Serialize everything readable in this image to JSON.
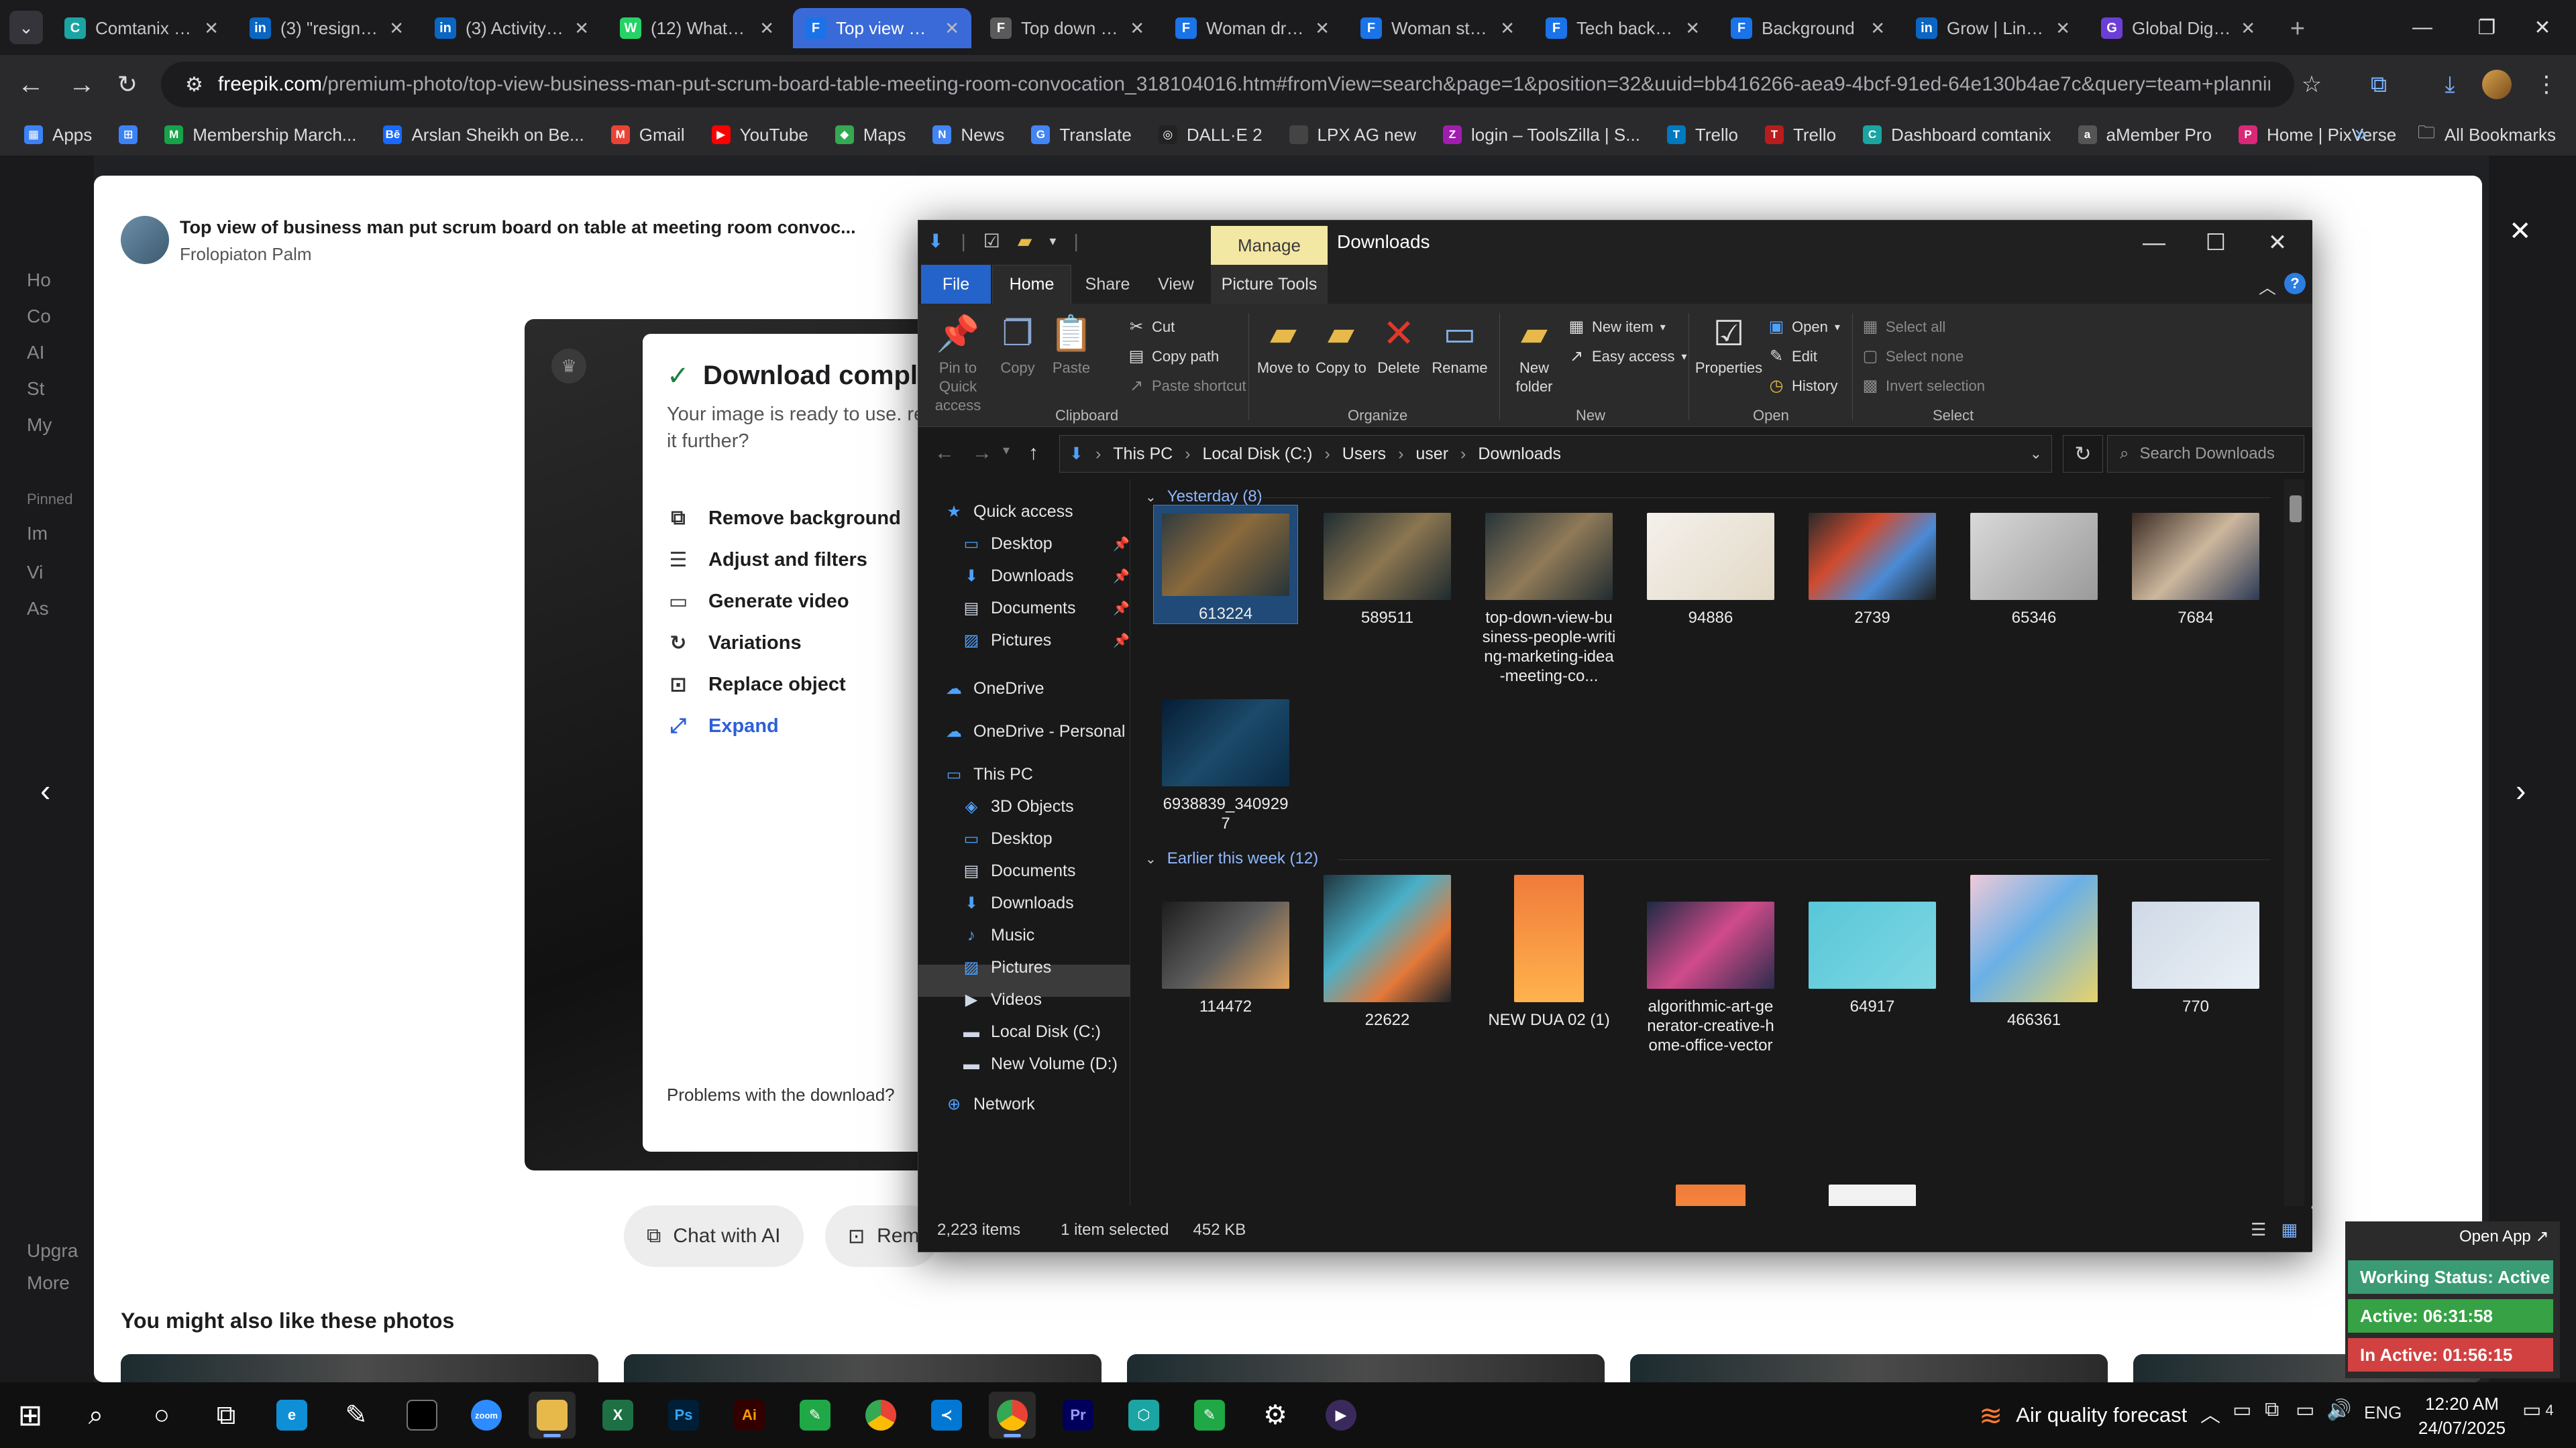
{
  "browser": {
    "tabs": [
      {
        "title": "Comtanix HR",
        "icon_color": "#1aa5a3",
        "icon": "C",
        "active": false
      },
      {
        "title": "(3) \"resignation\"",
        "icon_color": "#0a66c2",
        "icon": "in",
        "active": false
      },
      {
        "title": "(3) Activity | LinkedIn",
        "icon_color": "#0a66c2",
        "icon": "in",
        "active": false
      },
      {
        "title": "(12) WhatsApp",
        "icon_color": "#25d366",
        "icon": "W",
        "active": false
      },
      {
        "title": "Top view of business man",
        "icon_color": "#1a73e8",
        "icon": "F",
        "active": true
      },
      {
        "title": "Top down view",
        "icon_color": "#5a5a5a",
        "icon": "F",
        "active": false
      },
      {
        "title": "Woman drawing",
        "icon_color": "#1a73e8",
        "icon": "F",
        "active": false
      },
      {
        "title": "Woman standing",
        "icon_color": "#1a73e8",
        "icon": "F",
        "active": false
      },
      {
        "title": "Tech background",
        "icon_color": "#1a73e8",
        "icon": "F",
        "active": false
      },
      {
        "title": "Background",
        "icon_color": "#1a73e8",
        "icon": "F",
        "active": false
      },
      {
        "title": "Grow | LinkedIn",
        "icon_color": "#0a66c2",
        "icon": "in",
        "active": false
      },
      {
        "title": "Global Digital",
        "icon_color": "#6b3fd6",
        "icon": "G",
        "active": false
      }
    ],
    "url_host": "freepik.com",
    "url_path": "/premium-photo/top-view-business-man-put-scrum-board-table-meeting-room-convocation_318104016.htm#fromView=search&page=1&position=32&uuid=bb416266-aea9-4bcf-91ed-64e130b4ae7c&query=team+planning+",
    "bookmarks": [
      {
        "label": "Apps",
        "color": "#3b82f6",
        "icon": "▦"
      },
      {
        "label": "",
        "color": "#3b82f6",
        "icon": "⊞"
      },
      {
        "label": "Membership March...",
        "color": "#16a34a",
        "icon": "M"
      },
      {
        "label": "Arslan Sheikh on Be...",
        "color": "#1769ff",
        "icon": "Bē"
      },
      {
        "label": "Gmail",
        "color": "#ea4335",
        "icon": "M"
      },
      {
        "label": "YouTube",
        "color": "#ff0000",
        "icon": "▶"
      },
      {
        "label": "Maps",
        "color": "#34a853",
        "icon": "◆"
      },
      {
        "label": "News",
        "color": "#4285f4",
        "icon": "N"
      },
      {
        "label": "Translate",
        "color": "#4285f4",
        "icon": "G"
      },
      {
        "label": "DALL·E 2",
        "color": "#222222",
        "icon": "◎"
      },
      {
        "label": "LPX AG new",
        "color": "#444444",
        "icon": " "
      },
      {
        "label": "login – ToolsZilla | S...",
        "color": "#a21caf",
        "icon": "Z"
      },
      {
        "label": "Trello",
        "color": "#0079bf",
        "icon": "T"
      },
      {
        "label": "Trello",
        "color": "#b91c1c",
        "icon": "T"
      },
      {
        "label": "Dashboard comtanix",
        "color": "#1aa5a3",
        "icon": "C"
      },
      {
        "label": "aMember Pro",
        "color": "#555555",
        "icon": "a"
      },
      {
        "label": "Home | PixVerse",
        "color": "#db2777",
        "icon": "P"
      }
    ],
    "all_bookmarks": "All Bookmarks"
  },
  "freepik": {
    "photo_title": "Top view of business man put scrum board on table at meeting room convoc...",
    "author": "Frolopiaton Palm",
    "download": {
      "title": "Download complete",
      "subtitle": "Your image is ready to use. refine it further?",
      "options": [
        {
          "label": "Remove background",
          "icon": "⧉",
          "link": false
        },
        {
          "label": "Adjust and filters",
          "icon": "☰",
          "link": false
        },
        {
          "label": "Generate video",
          "icon": "▭",
          "link": false
        },
        {
          "label": "Variations",
          "icon": "↻",
          "link": false
        },
        {
          "label": "Replace object",
          "icon": "⊡",
          "link": false
        },
        {
          "label": "Expand",
          "icon": "⤢",
          "link": true
        }
      ],
      "problems": "Problems with the download?"
    },
    "chat_ai": "Chat with AI",
    "remove_btn": "Remo",
    "also_like": "You might also like these photos",
    "sidebar": [
      "Ho",
      "Co",
      "AI",
      "St",
      "My",
      "Pinned",
      "Im",
      "Vi",
      "As",
      "Upgra",
      "More"
    ]
  },
  "explorer": {
    "title": "Downloads",
    "manage": "Manage",
    "tabs": {
      "file": "File",
      "home": "Home",
      "share": "Share",
      "view": "View",
      "picture": "Picture Tools"
    },
    "ribbon": {
      "pin": "Pin to Quick access",
      "copy": "Copy",
      "paste": "Paste",
      "cut": "Cut",
      "copy_path": "Copy path",
      "paste_shortcut": "Paste shortcut",
      "clipboard": "Clipboard",
      "move_to": "Move to",
      "copy_to": "Copy to",
      "delete": "Delete",
      "rename": "Rename",
      "organize": "Organize",
      "new_folder": "New folder",
      "new_item": "New item",
      "easy_access": "Easy access",
      "new": "New",
      "properties": "Properties",
      "open": "Open",
      "edit": "Edit",
      "history": "History",
      "open_group": "Open",
      "select_all": "Select all",
      "select_none": "Select none",
      "invert": "Invert selection",
      "select": "Select"
    },
    "breadcrumb": [
      "This PC",
      "Local Disk (C:)",
      "Users",
      "user",
      "Downloads"
    ],
    "search_placeholder": "Search Downloads",
    "nav": {
      "quick_access": "Quick access",
      "qa_items": [
        "Desktop",
        "Downloads",
        "Documents",
        "Pictures"
      ],
      "onedrive": "OneDrive",
      "onedrive_personal": "OneDrive - Personal",
      "this_pc": "This PC",
      "pc_items": [
        "3D Objects",
        "Desktop",
        "Documents",
        "Downloads",
        "Music",
        "Pictures",
        "Videos",
        "Local Disk (C:)",
        "New Volume (D:)"
      ],
      "network": "Network"
    },
    "groups": [
      {
        "label": "Yesterday (8)"
      },
      {
        "label": "Earlier this week (12)"
      }
    ],
    "yesterday_files": [
      "613224",
      "589511",
      "top-down-view-business-people-writing-marketing-idea-meeting-co...",
      "94886",
      "2739",
      "65346",
      "7684",
      "6938839_3409297"
    ],
    "week_files": [
      "114472",
      "22622",
      "NEW DUA 02 (1)",
      "algorithmic-art-generator-creative-home-office-vector",
      "64917",
      "466361",
      "770"
    ],
    "status": {
      "items": "2,223 items",
      "selected": "1 item selected",
      "size": "452 KB"
    }
  },
  "tracker": {
    "open_app": "Open App ↗",
    "working": "Working Status: Active",
    "active": "Active: 06:31:58",
    "inactive": "In Active: 01:56:15"
  },
  "taskbar": {
    "weather": "Air quality forecast",
    "lang": "ENG",
    "time": "12:20 AM",
    "date": "24/07/2025",
    "notif": "4"
  }
}
